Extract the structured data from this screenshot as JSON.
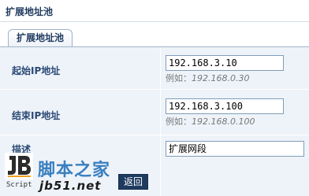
{
  "header": {
    "title": "扩展地址池"
  },
  "tabs": [
    {
      "label": "扩展地址池"
    }
  ],
  "form": {
    "start_ip": {
      "label": "起始IP地址",
      "value": "192.168.3.10",
      "hint_prefix": "例如：",
      "hint_example": "192.168.0.30"
    },
    "end_ip": {
      "label": "结束IP地址",
      "value": "192.168.3.100",
      "hint_prefix": "例如：",
      "hint_example": "192.168.0.100"
    },
    "description": {
      "label": "描述",
      "value": "扩展网段"
    }
  },
  "actions": {
    "back_label": "返回"
  },
  "watermark": {
    "logo_letter": "JB",
    "script_text": "Script",
    "cn_text": "脚本之家",
    "domain_text": "jb51.net"
  }
}
